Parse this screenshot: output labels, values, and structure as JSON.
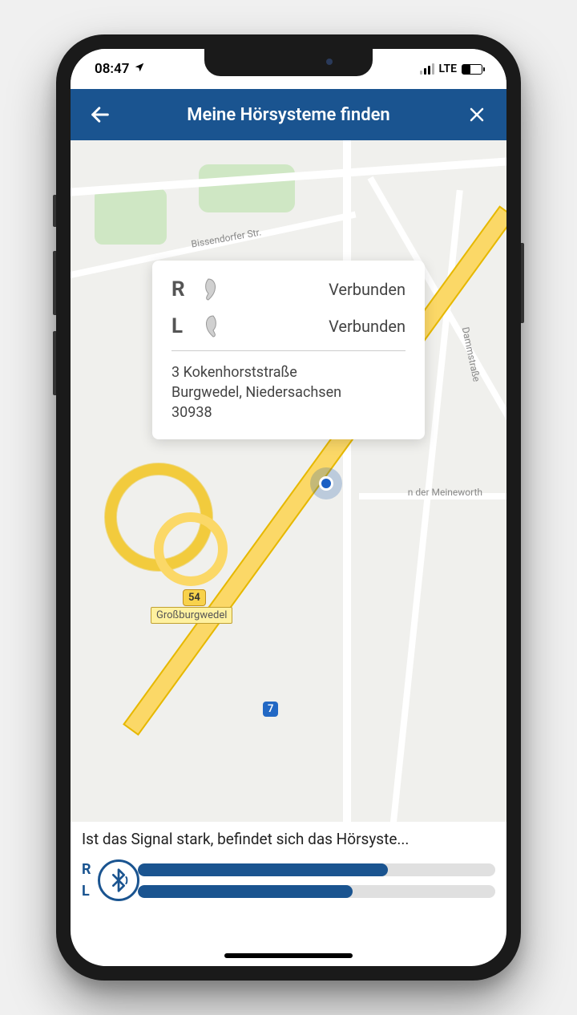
{
  "status": {
    "time": "08:47",
    "network": "LTE"
  },
  "header": {
    "title": "Meine Hörsysteme finden"
  },
  "info": {
    "right_label": "R",
    "right_status": "Verbunden",
    "left_label": "L",
    "left_status": "Verbunden",
    "address_line1": "3 Kokenhorststraße",
    "address_line2": "Burgwedel, Niedersachsen",
    "address_line3": "30938"
  },
  "map": {
    "street1": "Bissendorfer Str.",
    "street2": "Dammstraße",
    "street3": "n der Meineworth",
    "town": "Großburgwedel",
    "hwy_54": "54",
    "hwy_7": "7"
  },
  "footer": {
    "tip": "Ist das Signal stark, befindet sich das Hörsyste...",
    "r_label": "R",
    "l_label": "L",
    "r_strength": 70,
    "l_strength": 60
  }
}
